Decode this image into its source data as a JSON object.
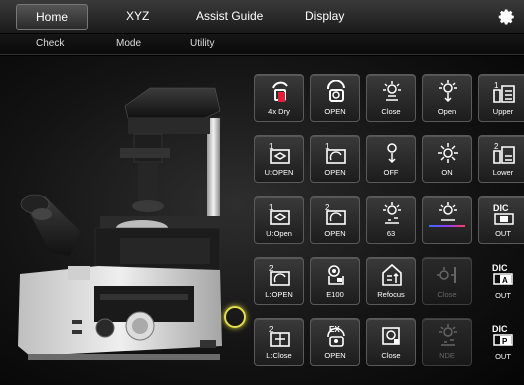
{
  "topnav": {
    "tabs": [
      {
        "label": "Home"
      },
      {
        "label": "XYZ"
      },
      {
        "label": "Assist Guide"
      },
      {
        "label": "Display"
      }
    ]
  },
  "subnav": {
    "tabs": [
      {
        "label": "Check"
      },
      {
        "label": "Mode"
      },
      {
        "label": "Utility"
      }
    ]
  },
  "buttons": {
    "r1": [
      "4x Dry",
      "OPEN",
      "Close",
      "Open",
      "Upper"
    ],
    "r2": [
      "U:OPEN",
      "OPEN",
      "OFF",
      "ON",
      "Lower"
    ],
    "r3": [
      "U:Open",
      "OPEN",
      "63",
      "",
      "OUT"
    ],
    "r4": [
      "L:OPEN",
      "E100",
      "Refocus",
      "Close",
      "OUT"
    ],
    "r5": [
      "L:Close",
      "OPEN",
      "Close",
      "NDE",
      "OUT"
    ]
  },
  "icon_text": {
    "r1c5": "1",
    "r2c1": "1",
    "r2c2": "1",
    "r2c5": "2",
    "r3c1": "1",
    "r3c2": "2",
    "r3c5": "DIC",
    "r4c1": "2",
    "r4c5": "DIC",
    "r4c5b": "A",
    "r5c1": "2",
    "r5c2": "EX",
    "r5c5": "DIC",
    "r5c5b": "P"
  },
  "colors": {
    "accent_ring": "#e5e04a",
    "button_border": "#5a5a5a",
    "disabled_text": "#666666"
  }
}
